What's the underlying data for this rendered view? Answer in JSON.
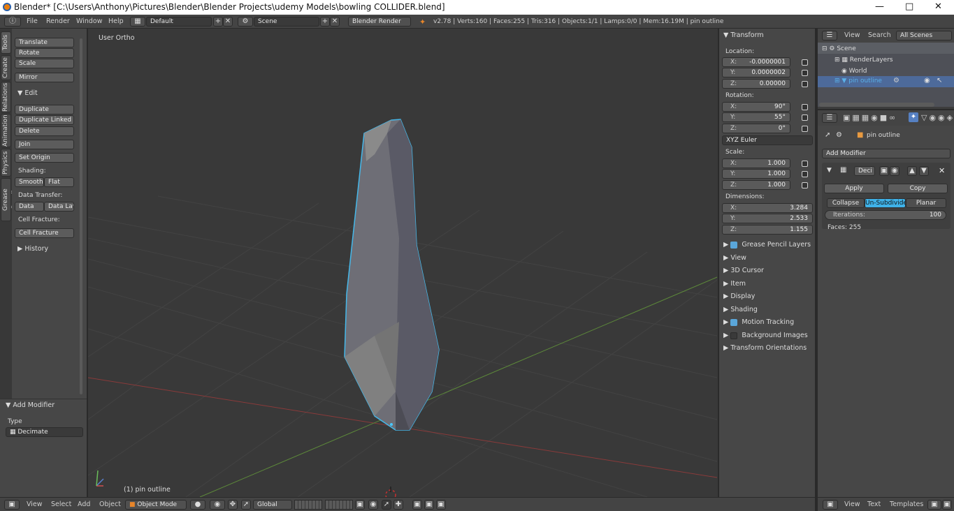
{
  "window": {
    "title": "Blender* [C:\\Users\\Anthony\\Pictures\\Blender\\Blender Projects\\udemy Models\\bowling COLLIDER.blend]"
  },
  "menubar": {
    "items": [
      "File",
      "Render",
      "Window",
      "Help"
    ],
    "screen_layout": "Default",
    "scene": "Scene",
    "render_engine": "Blender Render",
    "stats": "v2.78 | Verts:160 | Faces:255 | Tris:316 | Objects:1/1 | Lamps:0/0 | Mem:16.19M | pin outline"
  },
  "vertical_tabs": [
    "Tools",
    "Create",
    "Relations",
    "Animation",
    "Physics",
    "Grease Pencil"
  ],
  "toolshelf": {
    "transform_buttons": [
      "Translate",
      "Rotate",
      "Scale",
      "Mirror"
    ],
    "edit_header": "Edit",
    "edit_buttons": [
      "Duplicate",
      "Duplicate Linked",
      "Delete",
      "Join"
    ],
    "set_origin": "Set Origin",
    "shading_label": "Shading:",
    "smooth": "Smooth",
    "flat": "Flat",
    "data_transfer_label": "Data Transfer:",
    "data": "Data",
    "data_lay": "Data Lay",
    "cell_fracture_label": "Cell Fracture:",
    "cell_fracture_button": "Cell Fracture",
    "history": "History",
    "operator_header": "Add Modifier",
    "type_label": "Type",
    "type_value": "Decimate"
  },
  "viewport": {
    "view_name": "User Ortho",
    "object_label": "(1) pin outline"
  },
  "npanel": {
    "transform_header": "Transform",
    "location_label": "Location:",
    "location": [
      "-0.0000001",
      "0.0000002",
      "0.00000"
    ],
    "rotation_label": "Rotation:",
    "rotation": [
      "90°",
      "55°",
      "0°"
    ],
    "rotation_mode": "XYZ Euler",
    "scale_label": "Scale:",
    "scale": [
      "1.000",
      "1.000",
      "1.000"
    ],
    "dimensions_label": "Dimensions:",
    "dimensions": [
      "3.284",
      "2.533",
      "1.155"
    ],
    "axes": [
      "X:",
      "Y:",
      "Z:"
    ],
    "sections": [
      "Grease Pencil Layers",
      "View",
      "3D Cursor",
      "Item",
      "Display",
      "Shading",
      "Motion Tracking",
      "Background Images",
      "Transform Orientations"
    ]
  },
  "outliner": {
    "menu": [
      "View",
      "Search"
    ],
    "display_mode": "All Scenes",
    "items": [
      "Scene",
      "RenderLayers",
      "World",
      "pin outline"
    ]
  },
  "properties": {
    "object_name": "pin outline",
    "add_modifier": "Add Modifier",
    "modifier_name": "Deci",
    "apply": "Apply",
    "copy": "Copy",
    "modes": [
      "Collapse",
      "Un-Subdivide",
      "Planar"
    ],
    "iterations_label": "Iterations:",
    "iterations_value": "100",
    "faces": "Faces: 255"
  },
  "bottombar": {
    "menu": [
      "View",
      "Select",
      "Add",
      "Object"
    ],
    "mode": "Object Mode",
    "orientation": "Global",
    "right_menu": [
      "View",
      "Text",
      "Templates"
    ]
  },
  "colors": {
    "accent": "#5aa6d9",
    "selected": "#5680c2",
    "selection_outline": "#3fb2e8"
  }
}
